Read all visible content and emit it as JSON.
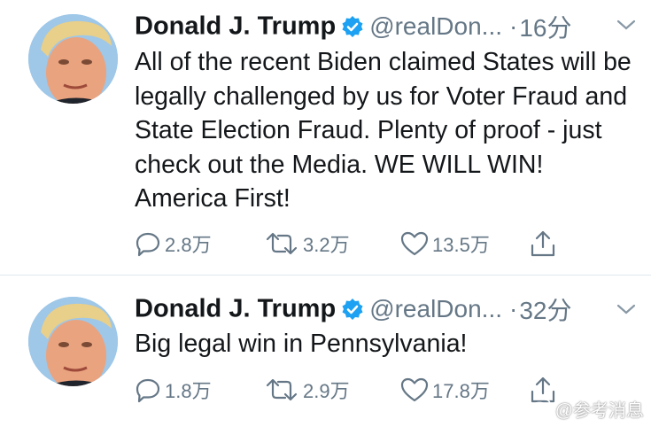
{
  "tweets": [
    {
      "author_name": "Donald J. Trump",
      "handle": "@realDon...",
      "separator": "·",
      "time": "16分",
      "text": "All of the recent Biden claimed States will be legally challenged by us for Voter Fraud and State Election Fraud. Plenty of proof - just check out the Media. WE WILL WIN! America First!",
      "replies": "2.8万",
      "retweets": "3.2万",
      "likes": "13.5万"
    },
    {
      "author_name": "Donald J. Trump",
      "handle": "@realDon...",
      "separator": "·",
      "time": "32分",
      "text": "Big legal win in Pennsylvania!",
      "replies": "1.8万",
      "retweets": "2.9万",
      "likes": "17.8万"
    }
  ],
  "watermark": "@参考消息",
  "colors": {
    "text": "#14171a",
    "secondary": "#657786",
    "verified": "#1da1f2",
    "divider": "#e1e8ed"
  },
  "icons": [
    "verified-badge-icon",
    "chevron-down-icon",
    "reply-icon",
    "retweet-icon",
    "like-icon",
    "share-icon",
    "weibo-logo-icon"
  ]
}
